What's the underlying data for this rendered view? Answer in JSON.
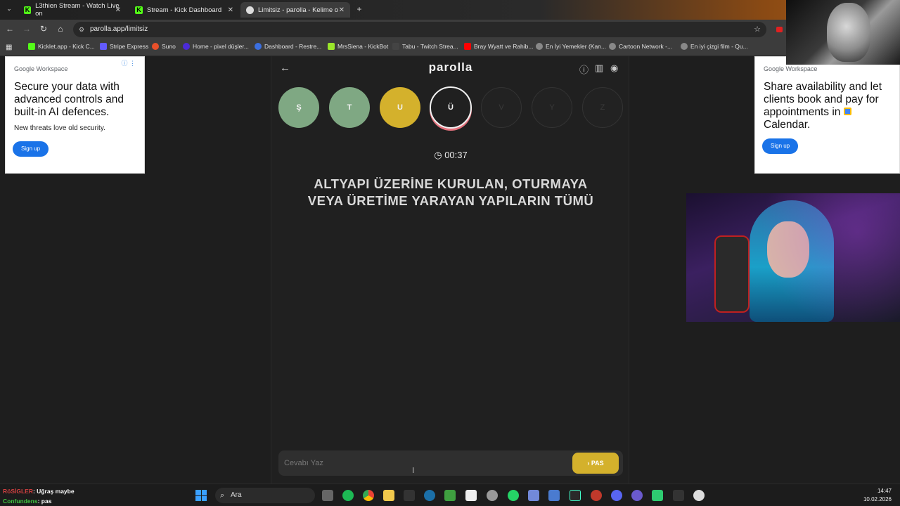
{
  "browser": {
    "tabs": [
      {
        "title": "L3thien Stream - Watch Live on"
      },
      {
        "title": "Stream - Kick Dashboard"
      },
      {
        "title": "Limitsiz - parolla - Kelime oyun"
      }
    ],
    "address": "parolla.app/limitsiz",
    "bookmarks": [
      {
        "label": "Kicklet.app - Kick C...",
        "color": "#53fc18"
      },
      {
        "label": "Stripe Express",
        "color": "#635bff"
      },
      {
        "label": "Suno",
        "color": "#e8502a"
      },
      {
        "label": "Home - pixel düşler...",
        "color": "#4b2ad8"
      },
      {
        "label": "Dashboard - Restre...",
        "color": "#3b6fe0"
      },
      {
        "label": "MrsSiena - KickBot",
        "color": "#9ae62a"
      },
      {
        "label": "Tabu - Twitch Strea...",
        "color": "#444"
      },
      {
        "label": "Bray Wyatt ve Rahib...",
        "color": "#ff0000"
      },
      {
        "label": "En İyi Yemekler (Kan...",
        "color": "#888"
      },
      {
        "label": "Cartoon Network -...",
        "color": "#888"
      },
      {
        "label": "En iyi çizgi film - Qu...",
        "color": "#888"
      }
    ]
  },
  "ads": {
    "left": {
      "brand_google": "Google",
      "brand_workspace": "Workspace",
      "headline": "Secure your data with advanced controls and built-in AI defences.",
      "subtext": "New threats love old security.",
      "cta": "Sign up"
    },
    "right": {
      "brand_google": "Google",
      "brand_workspace": "Workspace",
      "headline": "Share availability and let clients book and pay for appointments in",
      "headline_tail": "Calendar.",
      "cta": "Sign up"
    }
  },
  "game": {
    "title": "parolla",
    "letters": [
      {
        "letter": "Ş",
        "state": "correct"
      },
      {
        "letter": "T",
        "state": "correct"
      },
      {
        "letter": "U",
        "state": "passed"
      },
      {
        "letter": "Ü",
        "state": "current"
      },
      {
        "letter": "V",
        "state": "empty"
      },
      {
        "letter": "Y",
        "state": "empty"
      },
      {
        "letter": "Z",
        "state": "empty"
      }
    ],
    "timer": "00:37",
    "question": "ALTYAPI ÜZERİNE KURULAN, OTURMAYA VEYA ÜRETİME YARAYAN YAPILARIN TÜMÜ",
    "answer_placeholder": "Cevabı Yaz",
    "pass_label": "PAS"
  },
  "taskbar": {
    "chat": [
      {
        "user": "RöSİGLER",
        "message": ": Uğraş maybe"
      },
      {
        "user": "Confundens",
        "message": ": pas"
      }
    ],
    "search_label": "Ara",
    "time": "14:47",
    "date": "10.02.2026"
  },
  "colors": {
    "correct": "#7fa883",
    "passed": "#d4b12c",
    "current_ring": "#e5737e",
    "pass_button": "#d4b12c"
  }
}
